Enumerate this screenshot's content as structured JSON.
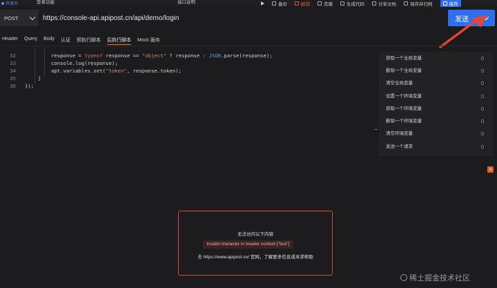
{
  "topbar": {
    "status": "开发中",
    "request_name": "登录功能",
    "doc_label": "接口说明",
    "tools": {
      "backup": "备份",
      "unlock": "解锁",
      "clone": "克隆",
      "generate_code": "生成代码",
      "share_doc": "分享文档",
      "save_and_archive": "保存并归档",
      "save": "保存"
    }
  },
  "request": {
    "method": "POST",
    "url": "https://console-api.apipost.cn/api/demo/login",
    "send_label": "发送"
  },
  "tabs": [
    {
      "label": "Header"
    },
    {
      "label": "Query"
    },
    {
      "label": "Body"
    },
    {
      "label": "认证"
    },
    {
      "label": "预执行脚本"
    },
    {
      "label": "后执行脚本",
      "active": true
    },
    {
      "label": "Mock 服务"
    }
  ],
  "editor": {
    "line_numbers": [
      "32",
      "33",
      "34",
      "35",
      "36"
    ],
    "lines": [
      "response = typeof response == \"object\" ? response : JSON.parse(response);",
      "console.log(response);",
      "apt.variables.set(\"token\", response.token);",
      "}",
      "});"
    ]
  },
  "snippets": [
    "获取一个全局变量",
    "删除一个全局变量",
    "清空全局变量",
    "设置一个环境变量",
    "获取一个环境变量",
    "删除一个环境变量",
    "清空环境变量",
    "发送一个请求"
  ],
  "error": {
    "title": "无法访问以下内容",
    "message": "Invalid character in header content [\"test\"]",
    "help": "去 https://www.apipost.cn/ 官网，了解更多信息或寻求帮助"
  },
  "watermark": "稀土掘金技术社区",
  "colors": {
    "accent": "#2f6fed",
    "error": "#e0443a",
    "tab_active": "#e07a3c"
  }
}
